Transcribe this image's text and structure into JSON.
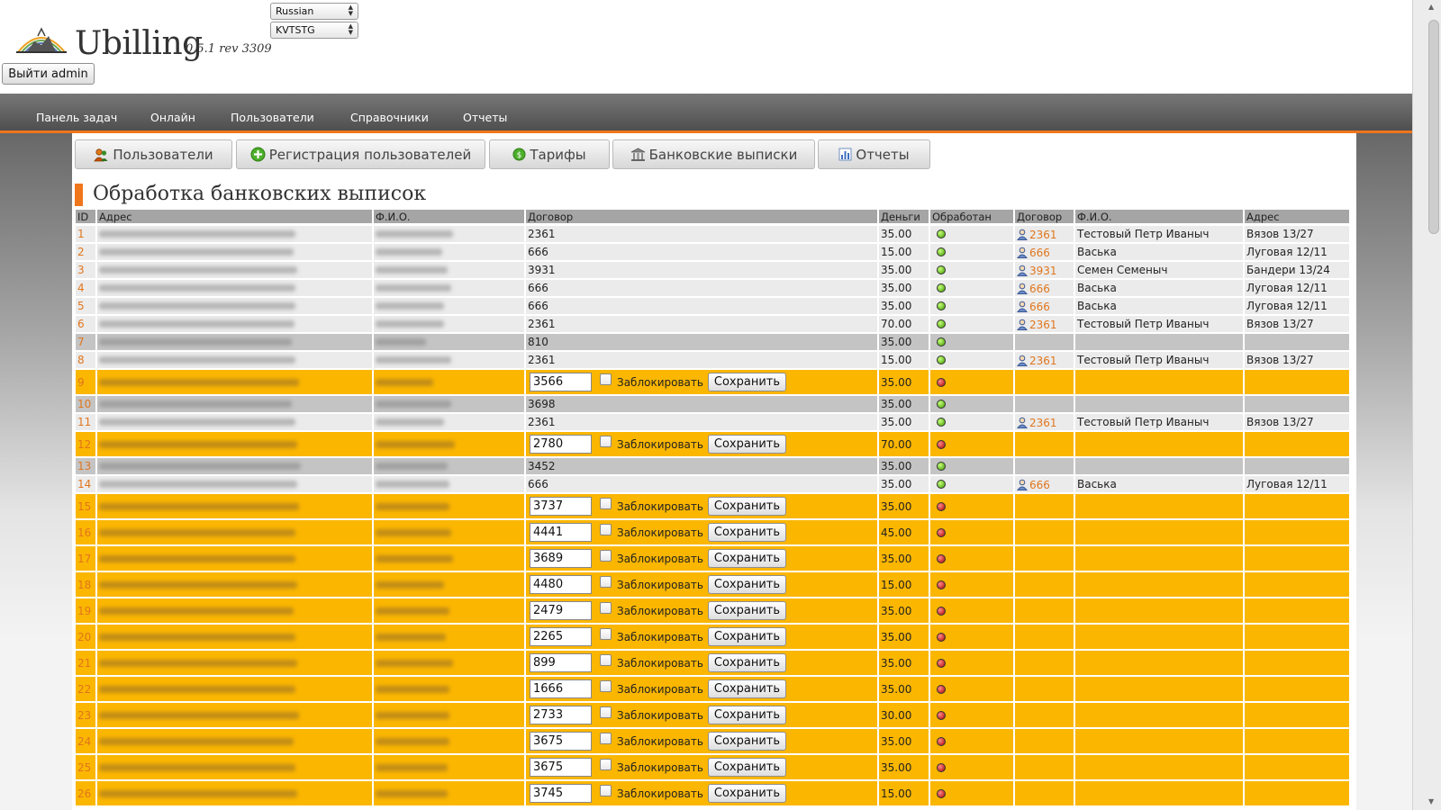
{
  "app": {
    "name": "Ubilling",
    "version": "0.5.1 rev 3309",
    "logout_label": "Выйти admin",
    "language": "Russian",
    "skin": "KVTSTG"
  },
  "nav": [
    "Панель задач",
    "Онлайн",
    "Пользователи",
    "Справочники",
    "Отчеты"
  ],
  "tabs": [
    {
      "label": "Пользователи",
      "icon": "users-icon"
    },
    {
      "label": "Регистрация пользователей",
      "icon": "add-icon"
    },
    {
      "label": "Тарифы",
      "icon": "money-icon"
    },
    {
      "label": "Банковские выписки",
      "icon": "bank-icon"
    },
    {
      "label": "Отчеты",
      "icon": "chart-icon"
    }
  ],
  "page_title": "Обработка банковских выписок",
  "columns": [
    "ID",
    "Адрес",
    "Ф.И.О.",
    "Договор",
    "Деньги",
    "Обработан",
    "Договор",
    "Ф.И.О.",
    "Адрес"
  ],
  "block_label": "Заблокировать",
  "save_label": "Сохранить",
  "colors": {
    "accent": "#f0761c",
    "unprocessed_row": "#fbb600",
    "processed_row": "#ebebeb",
    "unmatched_row": "#c4c4c4",
    "link": "#e0761d"
  },
  "rows": [
    {
      "id": "1",
      "status": "processed",
      "contract": "2361",
      "money": "35.00",
      "user_contract": "2361",
      "user_name": "Тестовый Петр Иваныч",
      "user_address": "Вязов 13/27"
    },
    {
      "id": "2",
      "status": "processed",
      "contract": "666",
      "money": "15.00",
      "user_contract": "666",
      "user_name": "Васька",
      "user_address": "Луговая 12/11"
    },
    {
      "id": "3",
      "status": "processed",
      "contract": "3931",
      "money": "35.00",
      "user_contract": "3931",
      "user_name": "Семен Семеныч",
      "user_address": "Бандери 13/24"
    },
    {
      "id": "4",
      "status": "processed",
      "contract": "666",
      "money": "35.00",
      "user_contract": "666",
      "user_name": "Васька",
      "user_address": "Луговая 12/11"
    },
    {
      "id": "5",
      "status": "processed",
      "contract": "666",
      "money": "35.00",
      "user_contract": "666",
      "user_name": "Васька",
      "user_address": "Луговая 12/11"
    },
    {
      "id": "6",
      "status": "processed",
      "contract": "2361",
      "money": "70.00",
      "user_contract": "2361",
      "user_name": "Тестовый Петр Иваныч",
      "user_address": "Вязов 13/27"
    },
    {
      "id": "7",
      "status": "unmatched",
      "contract": "810",
      "money": "35.00",
      "user_contract": "",
      "user_name": "",
      "user_address": ""
    },
    {
      "id": "8",
      "status": "processed",
      "contract": "2361",
      "money": "15.00",
      "user_contract": "2361",
      "user_name": "Тестовый Петр Иваныч",
      "user_address": "Вязов 13/27"
    },
    {
      "id": "9",
      "status": "new",
      "contract": "3566",
      "money": "35.00"
    },
    {
      "id": "10",
      "status": "unmatched",
      "contract": "3698",
      "money": "35.00",
      "user_contract": "",
      "user_name": "",
      "user_address": ""
    },
    {
      "id": "11",
      "status": "processed",
      "contract": "2361",
      "money": "35.00",
      "user_contract": "2361",
      "user_name": "Тестовый Петр Иваныч",
      "user_address": "Вязов 13/27"
    },
    {
      "id": "12",
      "status": "new",
      "contract": "2780",
      "money": "70.00"
    },
    {
      "id": "13",
      "status": "unmatched",
      "contract": "3452",
      "money": "35.00",
      "user_contract": "",
      "user_name": "",
      "user_address": ""
    },
    {
      "id": "14",
      "status": "processed",
      "contract": "666",
      "money": "35.00",
      "user_contract": "666",
      "user_name": "Васька",
      "user_address": "Луговая 12/11"
    },
    {
      "id": "15",
      "status": "new",
      "contract": "3737",
      "money": "35.00"
    },
    {
      "id": "16",
      "status": "new",
      "contract": "4441",
      "money": "45.00"
    },
    {
      "id": "17",
      "status": "new",
      "contract": "3689",
      "money": "35.00"
    },
    {
      "id": "18",
      "status": "new",
      "contract": "4480",
      "money": "15.00"
    },
    {
      "id": "19",
      "status": "new",
      "contract": "2479",
      "money": "35.00"
    },
    {
      "id": "20",
      "status": "new",
      "contract": "2265",
      "money": "35.00"
    },
    {
      "id": "21",
      "status": "new",
      "contract": "899",
      "money": "35.00"
    },
    {
      "id": "22",
      "status": "new",
      "contract": "1666",
      "money": "35.00"
    },
    {
      "id": "23",
      "status": "new",
      "contract": "2733",
      "money": "30.00"
    },
    {
      "id": "24",
      "status": "new",
      "contract": "3675",
      "money": "35.00"
    },
    {
      "id": "25",
      "status": "new",
      "contract": "3675",
      "money": "35.00"
    },
    {
      "id": "26",
      "status": "new",
      "contract": "3745",
      "money": "15.00"
    }
  ]
}
